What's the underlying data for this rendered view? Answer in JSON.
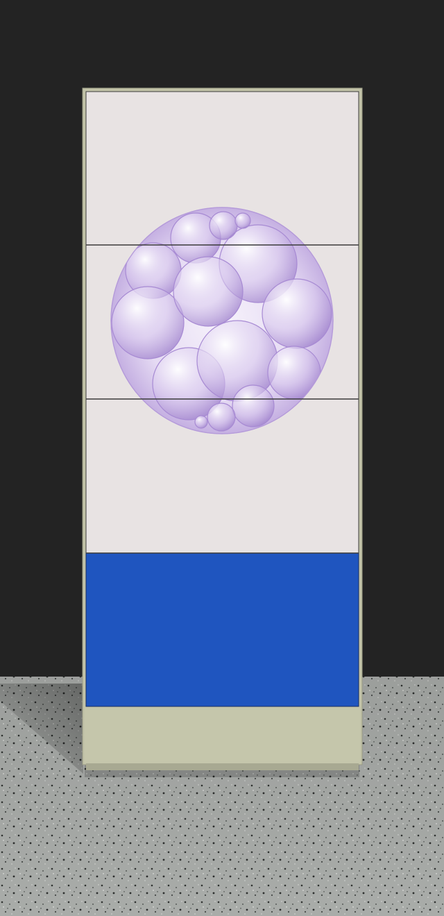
{
  "scene": {
    "description_subject": "cabinet-with-orb-artwork",
    "colors": {
      "wall": "#232323",
      "floor_base": "#a7aaa7",
      "cabinet_frame": "#c2c3a8",
      "cabinet_base": "#c4c5aa",
      "panel_light": "#e8e3e3",
      "panel_divider": "#3b3b3b",
      "bottom_drawer": "#1f55bf",
      "orb_tint": "#b8a0d8"
    },
    "drawer_count": 4
  }
}
